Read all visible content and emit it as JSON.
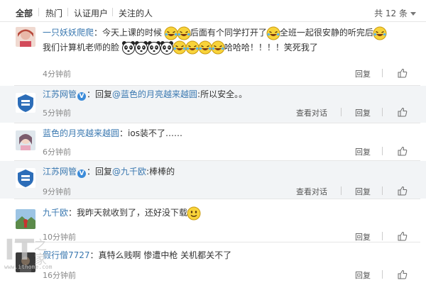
{
  "tabs": [
    {
      "label": "全部"
    },
    {
      "label": "热门"
    },
    {
      "label": "认证用户"
    },
    {
      "label": "关注的人"
    }
  ],
  "total": "共 12 条",
  "actions": {
    "view": "查看对话",
    "reply": "回复"
  },
  "comments": [
    {
      "user": "一只妖妖爬爬",
      "p1": "：今天上课的时候",
      "p2": "后面有个同学打开了",
      "p3": "全班一起很安静的听完后",
      "p4": "我们计算机老师的脸",
      "p5": "哈哈哈！！！！笑死我了",
      "time": "4分钟前"
    },
    {
      "user": "江苏网管",
      "pre": "：回复",
      "mention": "@蓝色的月亮越来越圆",
      "post": ":所以安全。。",
      "time": "5分钟前"
    },
    {
      "user": "蓝色的月亮越来越圆",
      "post": "：ios装不了……",
      "time": "6分钟前"
    },
    {
      "user": "江苏网管",
      "pre": "：回复",
      "mention": "@九千欧",
      "post": ":棒棒的",
      "time": "9分钟前"
    },
    {
      "user": "九千欧",
      "post": "：我昨天就收到了，还好没下载",
      "time": "10分钟前"
    },
    {
      "user": "假行僧7727",
      "post": "：真特么贱啊 惨遭中枪 关机都关不了",
      "time": "16分钟前"
    }
  ],
  "watermark": {
    "logo": "IT之家",
    "url": "www.ithome.com"
  }
}
